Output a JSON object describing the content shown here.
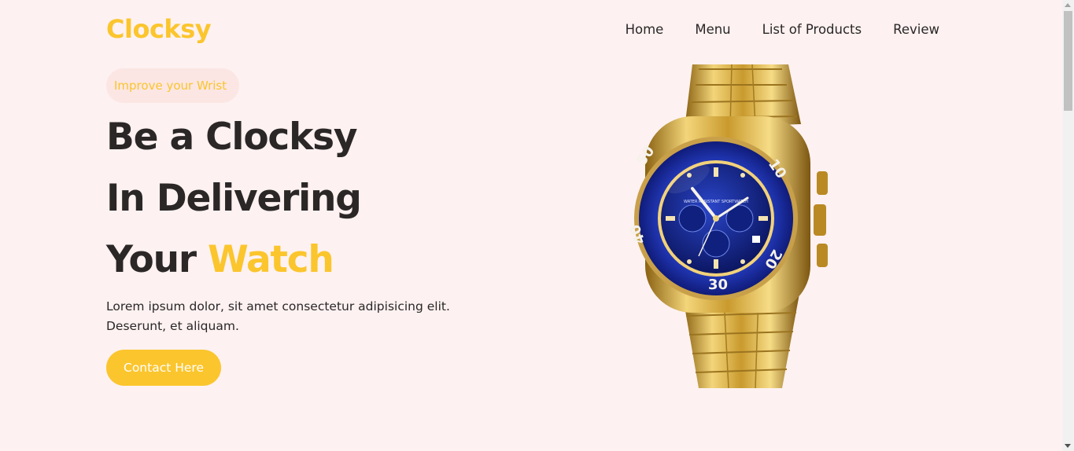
{
  "brand": {
    "logo": "Clocksy"
  },
  "nav": {
    "items": [
      {
        "label": "Home"
      },
      {
        "label": "Menu"
      },
      {
        "label": "List of Products"
      },
      {
        "label": "Review"
      }
    ]
  },
  "hero": {
    "tagline": "Improve your Wrist",
    "headline_line1": "Be a Clocksy",
    "headline_line2": "In Delivering",
    "headline_line3_prefix": "Your ",
    "headline_line3_accent": "Watch",
    "description": "Lorem ipsum dolor, sit amet consectetur adipisicing elit. Deserunt, et aliquam.",
    "cta_label": "Contact Here"
  },
  "watch_dial": {
    "bezel_numbers": [
      "50",
      "10",
      "20",
      "30",
      "40"
    ],
    "dial_text": "WATER RESISTANT SPORTWATCH"
  },
  "colors": {
    "accent": "#fbc52d",
    "text": "#2b2727",
    "background": "#fdf1f1",
    "pill_background": "#fbe6e3",
    "bezel_blue": "#1b2fa8",
    "gold": "#d4a732"
  }
}
